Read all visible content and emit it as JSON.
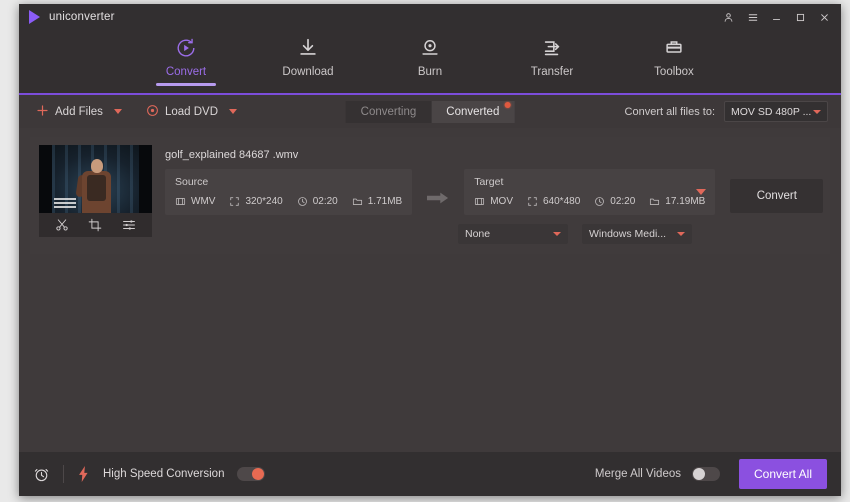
{
  "window": {
    "app_title": "uniconverter",
    "logo_icon": "play-triangle-icon",
    "controls": {
      "account": "account-icon",
      "menu": "hamburger-menu-icon",
      "minimize": "minimize-icon",
      "maximize": "maximize-icon",
      "close": "close-icon"
    }
  },
  "nav": {
    "items": [
      {
        "label": "Convert",
        "icon": "convert-circle-play-icon",
        "active": true
      },
      {
        "label": "Download",
        "icon": "download-arrow-icon",
        "active": false
      },
      {
        "label": "Burn",
        "icon": "burn-disc-icon",
        "active": false
      },
      {
        "label": "Transfer",
        "icon": "transfer-device-icon",
        "active": false
      },
      {
        "label": "Toolbox",
        "icon": "toolbox-icon",
        "active": false
      }
    ],
    "active_color": "#9b6de8",
    "underline_color": "#7c4ddb"
  },
  "toolbar": {
    "add_files_label": "Add Files",
    "add_files_icon": "plus-icon",
    "load_dvd_label": "Load DVD",
    "load_dvd_icon": "disc-icon",
    "segments": [
      {
        "label": "Converting",
        "active": false,
        "badge": false
      },
      {
        "label": "Converted",
        "active": true,
        "badge": true
      }
    ],
    "convert_all_to_label": "Convert all files to:",
    "convert_all_to_value": "MOV SD 480P  ...",
    "accent_color": "#e0685a"
  },
  "file": {
    "name": "golf_explained 84687 .wmv",
    "thumbnail_tools": [
      {
        "name": "trim-scissors-icon"
      },
      {
        "name": "crop-icon"
      },
      {
        "name": "effects-sliders-icon"
      }
    ],
    "source": {
      "title": "Source",
      "format": "WMV",
      "resolution": "320*240",
      "duration": "02:20",
      "size": "1.71MB"
    },
    "target": {
      "title": "Target",
      "format": "MOV",
      "resolution": "640*480",
      "duration": "02:20",
      "size": "17.19MB"
    },
    "subtitle_select": "None",
    "audio_select": "Windows Medi...",
    "convert_button": "Convert",
    "arrow_icon": "right-arrow-icon"
  },
  "footer": {
    "timer_icon": "alarm-clock-icon",
    "speed_icon": "lightning-bolt-icon",
    "high_speed_label": "High Speed Conversion",
    "high_speed_on": true,
    "merge_label": "Merge All Videos",
    "merge_on": false,
    "convert_all_label": "Convert All",
    "convert_all_color": "#8b50e0"
  }
}
